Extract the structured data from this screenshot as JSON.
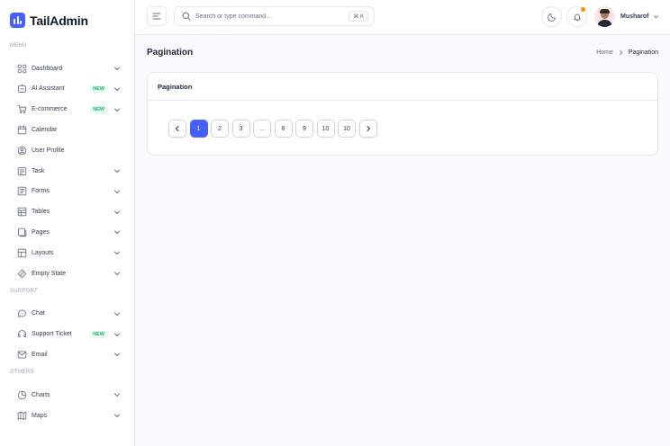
{
  "app": {
    "name": "TailAdmin"
  },
  "sidebar": {
    "groups": [
      {
        "title": "MENU",
        "items": [
          {
            "label": "Dashboard",
            "icon": "grid-icon",
            "expandable": true
          },
          {
            "label": "AI Assistant",
            "icon": "ai-icon",
            "badge": "NEW",
            "expandable": true
          },
          {
            "label": "E-commerce",
            "icon": "cart-icon",
            "badge": "NEW",
            "expandable": true
          },
          {
            "label": "Calendar",
            "icon": "calendar-icon",
            "expandable": false
          },
          {
            "label": "User Profile",
            "icon": "user-circle-icon",
            "expandable": false
          },
          {
            "label": "Task",
            "icon": "task-icon",
            "expandable": true
          },
          {
            "label": "Forms",
            "icon": "forms-icon",
            "expandable": true
          },
          {
            "label": "Tables",
            "icon": "table-icon",
            "expandable": true
          },
          {
            "label": "Pages",
            "icon": "pages-icon",
            "expandable": true
          },
          {
            "label": "Layouts",
            "icon": "layouts-icon",
            "expandable": true
          },
          {
            "label": "Empty State",
            "icon": "empty-state-icon",
            "expandable": true
          }
        ]
      },
      {
        "title": "SUPPORT",
        "items": [
          {
            "label": "Chat",
            "icon": "chat-icon",
            "expandable": true
          },
          {
            "label": "Support Ticket",
            "icon": "headset-icon",
            "badge": "NEW",
            "expandable": true
          },
          {
            "label": "Email",
            "icon": "mail-icon",
            "expandable": true
          }
        ]
      },
      {
        "title": "OTHERS",
        "items": [
          {
            "label": "Charts",
            "icon": "pie-chart-icon",
            "expandable": true
          },
          {
            "label": "Maps",
            "icon": "map-icon",
            "expandable": true
          }
        ]
      }
    ]
  },
  "header": {
    "search_placeholder": "Search or type command...",
    "search_shortcut": "⌘ K",
    "user_name": "Musharof",
    "has_notification": true
  },
  "main": {
    "page_title": "Pagination",
    "breadcrumb": {
      "home": "Home",
      "current": "Pagination"
    },
    "card_title": "Pagination",
    "pagination": {
      "pages": [
        "1",
        "2",
        "3",
        "...",
        "8",
        "9",
        "10",
        "10"
      ],
      "active_index": 0
    }
  },
  "colors": {
    "brand": "#465fff",
    "badge_text": "#12b76a",
    "badge_bg": "#ecfdf3",
    "notification_dot": "#f79009"
  }
}
